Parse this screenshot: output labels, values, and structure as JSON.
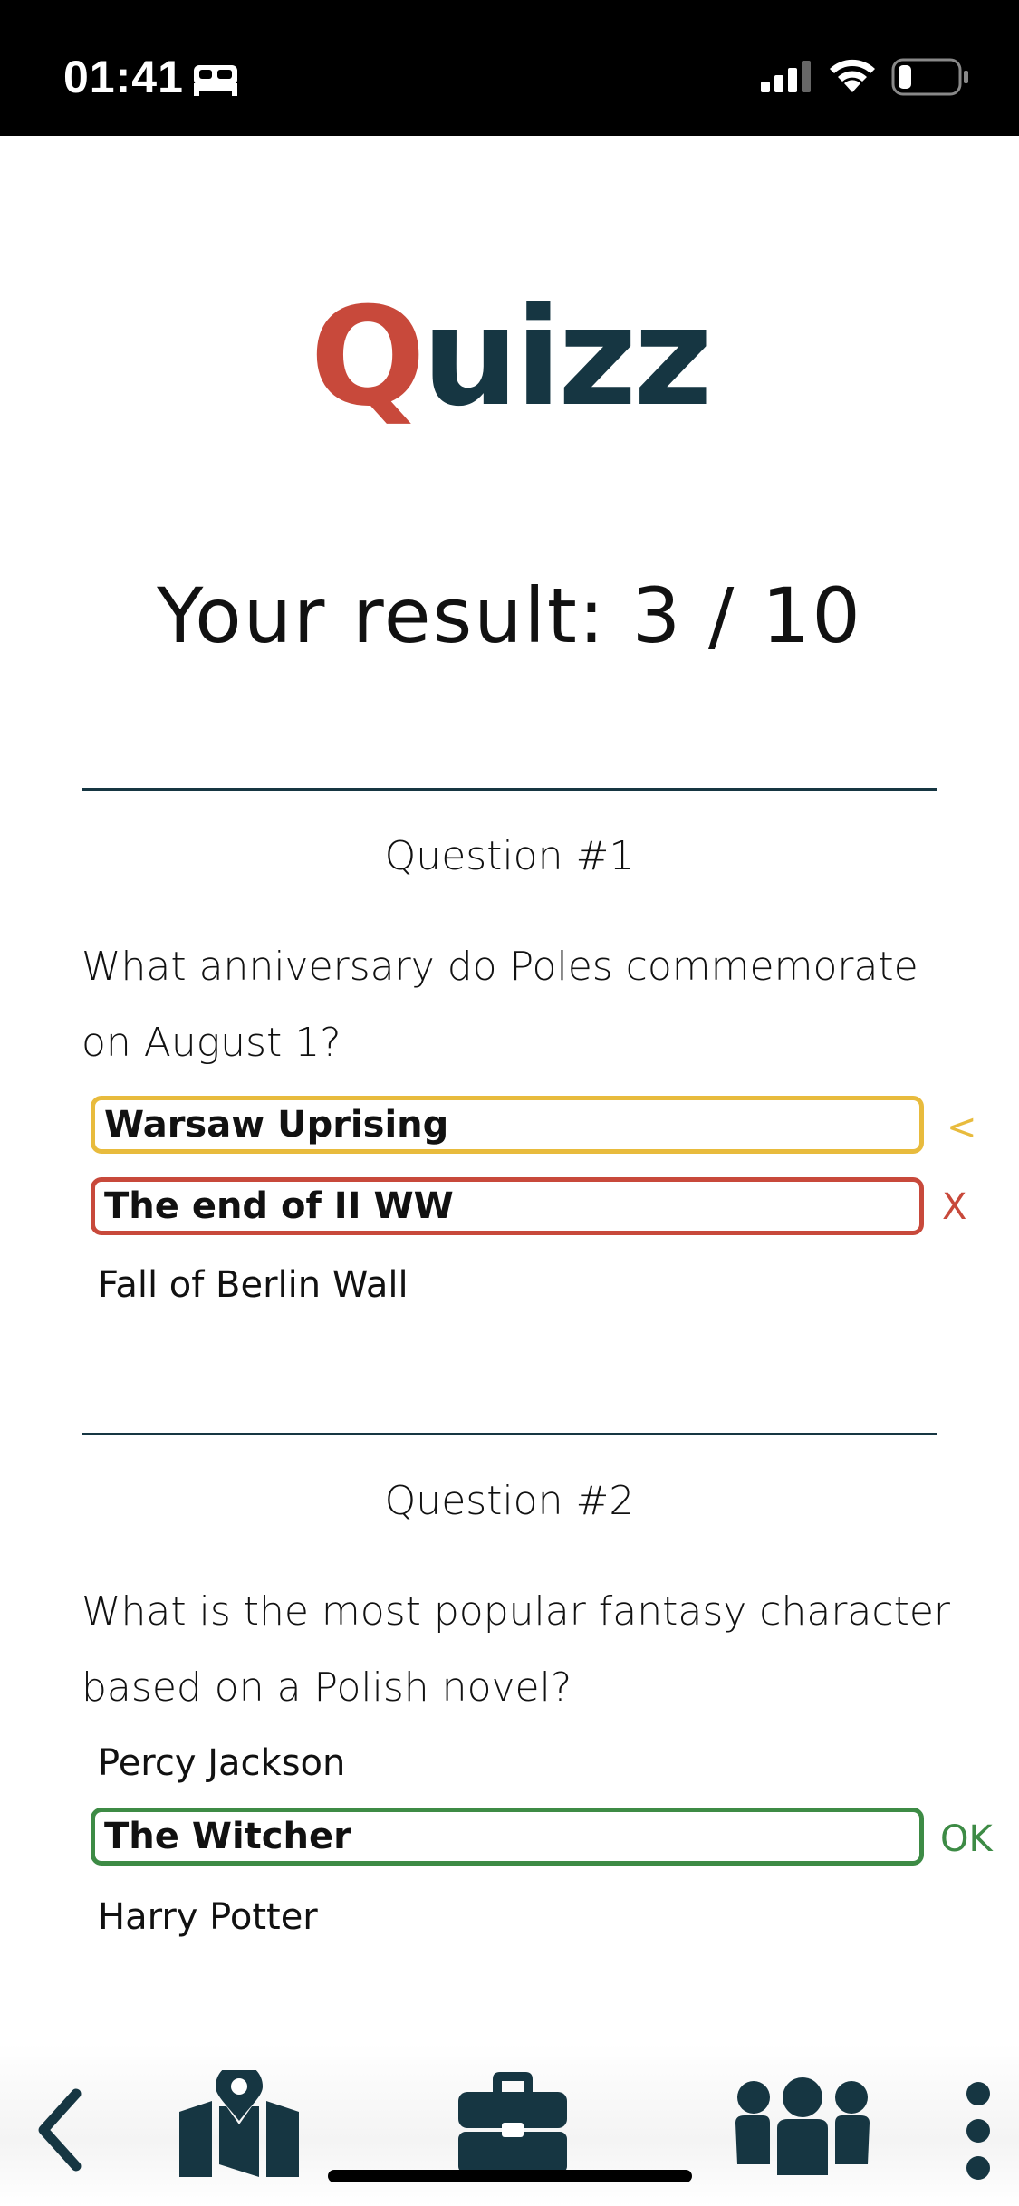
{
  "status_bar": {
    "time": "01:41",
    "icons": [
      "bed-icon",
      "signal-icon",
      "wifi-icon",
      "battery-icon"
    ]
  },
  "logo": {
    "q": "Q",
    "rest": "uizz"
  },
  "result_text": "Your result: 3 / 10",
  "colors": {
    "logo_red": "#c8493b",
    "navy": "#163642",
    "marked": "#e8bb3d",
    "wrong": "#c8493b",
    "correct": "#3d8b45"
  },
  "questions": [
    {
      "title": "Question #1",
      "text": "What anniversary do Poles commemorate on August 1?",
      "answers": [
        {
          "label": "Warsaw Uprising",
          "state": "highlighted",
          "marker": "<"
        },
        {
          "label": "The end of II WW",
          "state": "wrong",
          "marker": "X"
        },
        {
          "label": "Fall of Berlin Wall",
          "state": "none",
          "marker": ""
        }
      ]
    },
    {
      "title": "Question #2",
      "text": "What is the most popular fantasy character based on a Polish novel?",
      "answers": [
        {
          "label": "Percy Jackson",
          "state": "none",
          "marker": ""
        },
        {
          "label": "The Witcher",
          "state": "correct",
          "marker": "OK"
        },
        {
          "label": "Harry Potter",
          "state": "none",
          "marker": ""
        }
      ]
    }
  ],
  "bottom_nav": {
    "items": [
      "back-icon",
      "map-icon",
      "briefcase-icon",
      "group-icon",
      "more-icon"
    ]
  }
}
